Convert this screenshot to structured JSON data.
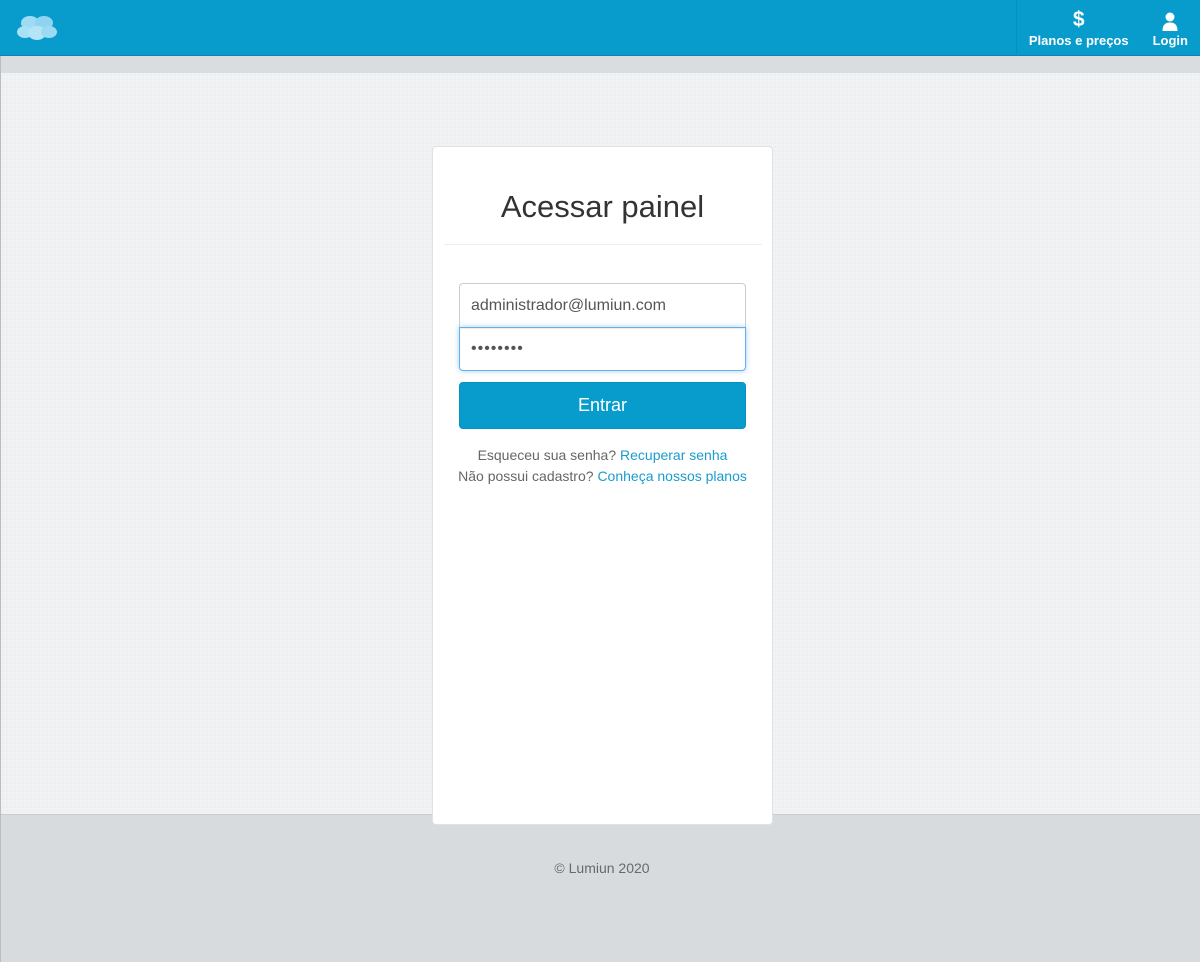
{
  "header": {
    "logo_icon": "cloud-logo-icon",
    "nav": [
      {
        "label": "Planos e preços",
        "icon": "dollar-icon",
        "glyph": "$"
      },
      {
        "label": "Login",
        "icon": "user-icon"
      }
    ]
  },
  "login": {
    "title": "Acessar painel",
    "email_value": "administrador@lumiun.com",
    "password_value": "••••••••",
    "submit_label": "Entrar",
    "forgot_text": "Esqueceu sua senha?",
    "forgot_link": "Recuperar senha",
    "signup_text": "Não possui cadastro?",
    "signup_link": "Conheça nossos planos"
  },
  "footer": {
    "copyright": "© Lumiun 2020"
  },
  "colors": {
    "brand": "#079ccc",
    "link": "#1a9ccd",
    "focus_border": "#66afe9"
  }
}
